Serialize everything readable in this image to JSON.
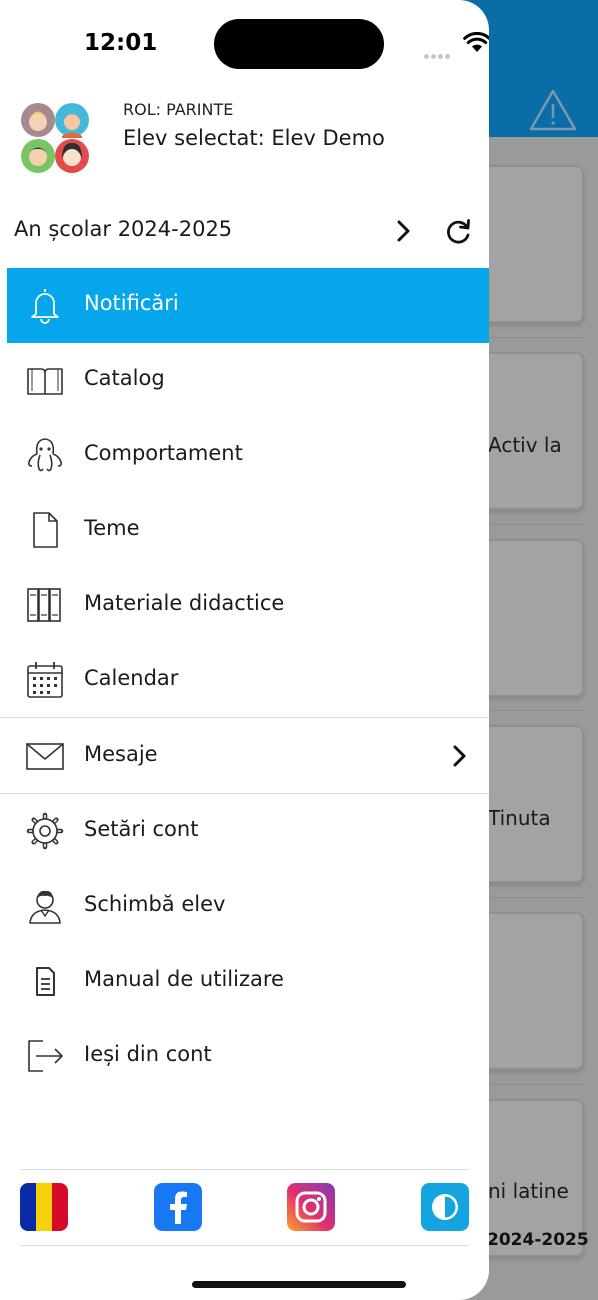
{
  "status_bar": {
    "time": "12:01"
  },
  "drawer": {
    "role": "ROL: PARINTE",
    "student": "Elev selectat: Elev Demo",
    "school_year": "An școlar 2024-2025",
    "menu": [
      {
        "label": "Notificări",
        "icon": "bell-icon",
        "active": true
      },
      {
        "label": "Catalog",
        "icon": "book-icon"
      },
      {
        "label": "Comportament",
        "icon": "octopus-icon"
      },
      {
        "label": "Teme",
        "icon": "document-icon"
      },
      {
        "label": "Materiale didactice",
        "icon": "books-icon"
      },
      {
        "label": "Calendar",
        "icon": "calendar-icon"
      },
      {
        "label": "Mesaje",
        "icon": "envelope-icon"
      },
      {
        "label": "Setări cont",
        "icon": "gear-icon"
      },
      {
        "label": "Schimbă elev",
        "icon": "user-switch-icon"
      },
      {
        "label": "Manual de utilizare",
        "icon": "manual-icon"
      },
      {
        "label": "Ieși din cont",
        "icon": "logout-icon"
      }
    ],
    "footer": [
      "romania-flag-icon",
      "facebook-icon",
      "instagram-icon",
      "contrast-icon"
    ]
  },
  "background": {
    "texts": [
      "Activ la",
      "Tinuta",
      "ni latine"
    ],
    "year": "2024-2025"
  },
  "colors": {
    "accent": "#06a6ea",
    "header": "#0a6da8"
  }
}
